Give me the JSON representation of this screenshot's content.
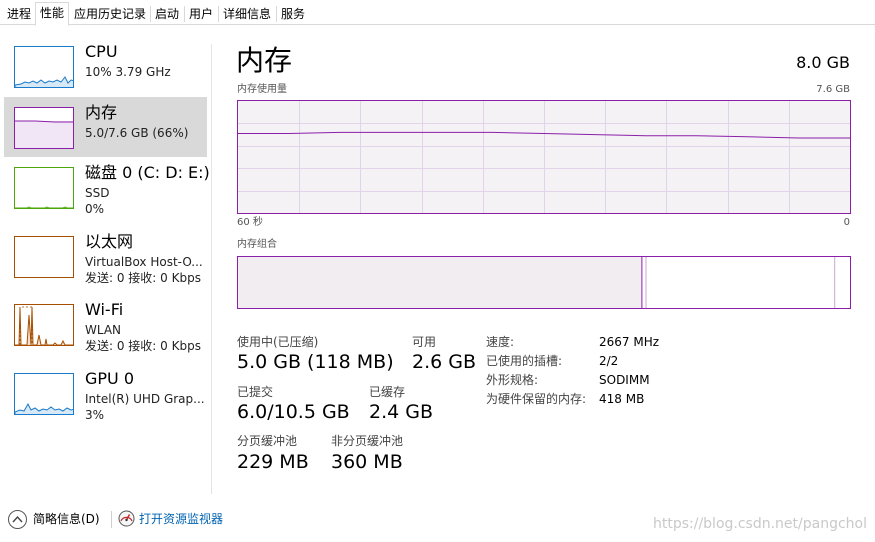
{
  "tabs": [
    {
      "label": "进程"
    },
    {
      "label": "性能"
    },
    {
      "label": "应用历史记录"
    },
    {
      "label": "启动"
    },
    {
      "label": "用户"
    },
    {
      "label": "详细信息"
    },
    {
      "label": "服务"
    }
  ],
  "active_tab": "性能",
  "sidebar": {
    "items": [
      {
        "title": "CPU",
        "sub": "10%  3.79 GHz",
        "sub2": "",
        "color": "#1979ca"
      },
      {
        "title": "内存",
        "sub": "5.0/7.6 GB (66%)",
        "sub2": "",
        "color": "#8b1fa9",
        "selected": true
      },
      {
        "title": "磁盘 0 (C: D: E:)",
        "sub": "SSD",
        "sub2": "0%",
        "color": "#4da60c"
      },
      {
        "title": "以太网",
        "sub": "VirtualBox Host-O...",
        "sub2": "发送: 0  接收: 0 Kbps",
        "color": "#a74f01"
      },
      {
        "title": "Wi-Fi",
        "sub": "WLAN",
        "sub2": "发送: 0  接收: 0 Kbps",
        "color": "#a74f01"
      },
      {
        "title": "GPU 0",
        "sub": "Intel(R) UHD Grap...",
        "sub2": "3%",
        "color": "#1979ca"
      }
    ]
  },
  "main": {
    "title": "内存",
    "total": "8.0 GB",
    "usage_graph_label": "内存使用量",
    "usage_graph_max": "7.6 GB",
    "time_left": "60 秒",
    "time_right": "0",
    "composition_label": "内存组合",
    "usage_history_fraction": [
      0.29,
      0.29,
      0.28,
      0.28,
      0.28,
      0.28,
      0.29,
      0.3,
      0.31,
      0.31,
      0.32,
      0.33,
      0.33
    ],
    "composition_in_use_fraction": 0.66,
    "composition_modified_fraction": 0.005,
    "composition_standby_fraction": 0.31
  },
  "stats": {
    "in_use_label": "使用中(已压缩)",
    "in_use_value": "5.0 GB (118 MB)",
    "available_label": "可用",
    "available_value": "2.6 GB",
    "committed_label": "已提交",
    "committed_value": "6.0/10.5 GB",
    "cached_label": "已缓存",
    "cached_value": "2.4 GB",
    "paged_label": "分页缓冲池",
    "paged_value": "229 MB",
    "nonpaged_label": "非分页缓冲池",
    "nonpaged_value": "360 MB"
  },
  "details": [
    {
      "label": "速度:",
      "value": "2667 MHz"
    },
    {
      "label": "已使用的插槽:",
      "value": "2/2"
    },
    {
      "label": "外形规格:",
      "value": "SODIMM"
    },
    {
      "label": "为硬件保留的内存:",
      "value": "418 MB"
    }
  ],
  "footer": {
    "fewer_details": "简略信息(D)",
    "open_monitor": "打开资源监视器",
    "watermark": "https://blog.csdn.net/pangchol"
  },
  "colors": {
    "memory_accent": "#8b1fa9",
    "link": "#0063b1"
  }
}
